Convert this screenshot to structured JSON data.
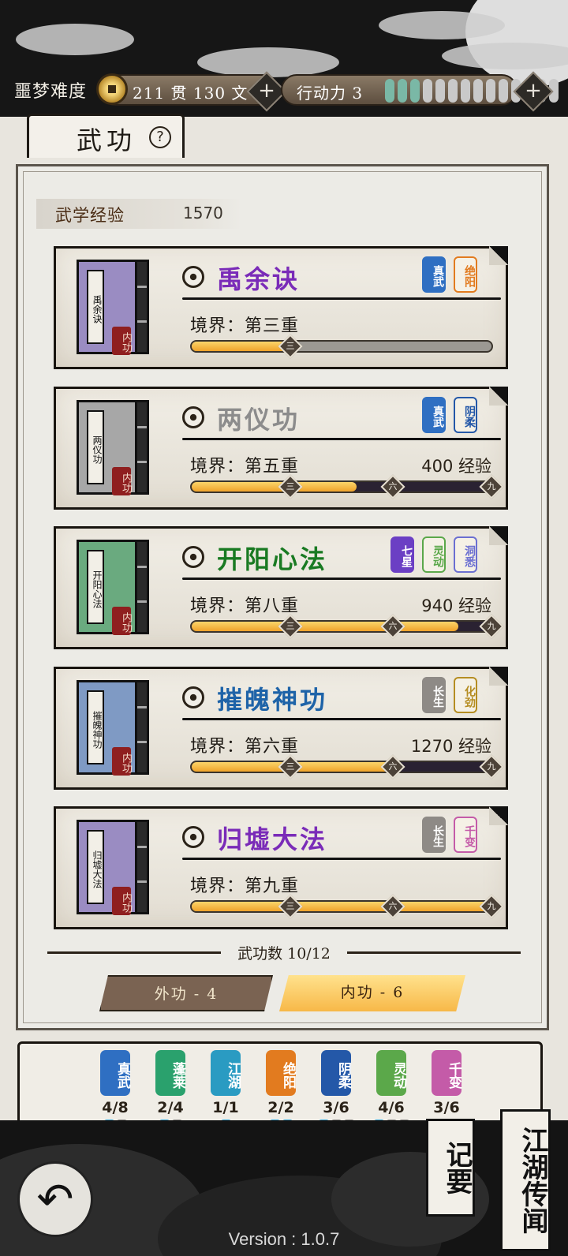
{
  "hud": {
    "difficulty": "噩梦难度",
    "money": "211 贯   130  文",
    "action_label": "行动力 3",
    "action_points": {
      "current": 3,
      "max": 14
    }
  },
  "tab": {
    "title": "武功",
    "help": "?"
  },
  "xp": {
    "label": "武学经验",
    "value": "1570"
  },
  "realm_prefix": "境界：",
  "skills": [
    {
      "book_title": "禹余诀",
      "book_seal": "内功",
      "book_color": "#9a8cc2",
      "name": "禹余诀",
      "name_color": "#7a2bb8",
      "tags": [
        {
          "text": "真武",
          "color": "#2f6fc2",
          "filled": true
        },
        {
          "text": "绝阳",
          "color": "#e27b1f",
          "filled": false
        }
      ],
      "realm": "第三重",
      "exp_need": "",
      "track_dark": false,
      "progress": 0.33
    },
    {
      "book_title": "两仪功",
      "book_seal": "内功",
      "book_color": "#a7a7a7",
      "name": "两仪功",
      "name_color": "#8c8c8c",
      "tags": [
        {
          "text": "真武",
          "color": "#2f6fc2",
          "filled": true
        },
        {
          "text": "阴柔",
          "color": "#2458a8",
          "filled": false
        }
      ],
      "realm": "第五重",
      "exp_need": "400 经验",
      "track_dark": true,
      "progress": 0.55
    },
    {
      "book_title": "开阳心法",
      "book_seal": "内功",
      "book_color": "#6aaa7f",
      "name": "开阳心法",
      "name_color": "#197a22",
      "tags": [
        {
          "text": "七星",
          "color": "#6b3fc4",
          "filled": true
        },
        {
          "text": "灵动",
          "color": "#5ba84a",
          "filled": false
        },
        {
          "text": "洞悉",
          "color": "#6b6fd1",
          "filled": false
        }
      ],
      "realm": "第八重",
      "exp_need": "940 经验",
      "track_dark": true,
      "progress": 0.89
    },
    {
      "book_title": "摧魄神功",
      "book_seal": "内功",
      "book_color": "#7f9ac4",
      "name": "摧魄神功",
      "name_color": "#1e63a8",
      "tags": [
        {
          "text": "长生",
          "color": "#8e8a86",
          "filled": true
        },
        {
          "text": "化劲",
          "color": "#b58d22",
          "filled": false
        }
      ],
      "realm": "第六重",
      "exp_need": "1270 经验",
      "track_dark": true,
      "progress": 0.67
    },
    {
      "book_title": "归墟大法",
      "book_seal": "内功",
      "book_color": "#9a8cc2",
      "name": "归墟大法",
      "name_color": "#7a2bb8",
      "tags": [
        {
          "text": "长生",
          "color": "#8e8a86",
          "filled": true
        },
        {
          "text": "千变",
          "color": "#c45ba8",
          "filled": false
        }
      ],
      "realm": "第九重",
      "exp_need": "",
      "track_dark": false,
      "progress": 1.0
    }
  ],
  "marks": {
    "m3": "三",
    "m6": "六",
    "m9": "九"
  },
  "count_text": "武功数 10/12",
  "filters": {
    "outer": "外功 - 4",
    "inner": "内功 - 6"
  },
  "schools": [
    {
      "text": "真武",
      "color": "#2f6fc2",
      "value": "4/8",
      "on": 1,
      "total": 2
    },
    {
      "text": "蓬莱",
      "color": "#2aa16d",
      "value": "2/4",
      "on": 1,
      "total": 2
    },
    {
      "text": "江湖",
      "color": "#2a9bc2",
      "value": "1/1",
      "on": 1,
      "total": 1
    },
    {
      "text": "绝阳",
      "color": "#e27b1f",
      "value": "2/2",
      "on": 2,
      "total": 2
    },
    {
      "text": "阴柔",
      "color": "#2458a8",
      "value": "3/6",
      "on": 1,
      "total": 3
    },
    {
      "text": "灵动",
      "color": "#5ba84a",
      "value": "4/6",
      "on": 1,
      "total": 3
    },
    {
      "text": "千变",
      "color": "#c45ba8",
      "value": "3/6",
      "on": 0,
      "total": 0
    }
  ],
  "buttons": {
    "memo": "记要",
    "legend": "江湖传闻",
    "back": "↶"
  },
  "version": "Version : 1.0.7"
}
